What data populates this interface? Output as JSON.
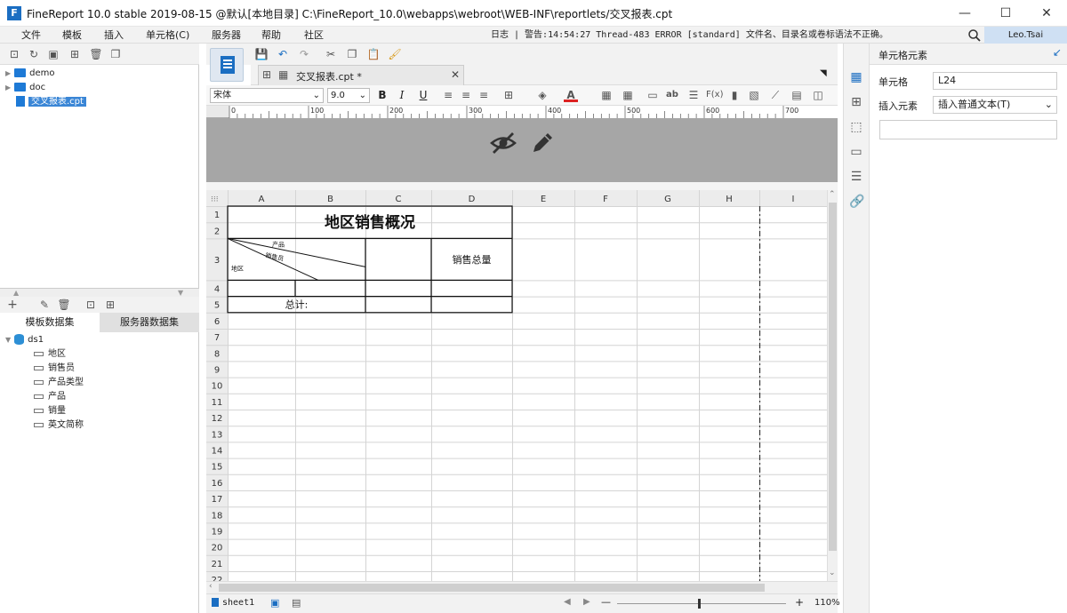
{
  "window": {
    "title": "FineReport 10.0 stable 2019-08-15 @默认[本地目录]    C:\\FineReport_10.0\\webapps\\webroot\\WEB-INF\\reportlets/交叉报表.cpt",
    "app_logo": "F",
    "minimize": "—",
    "maximize": "☐",
    "close": "✕"
  },
  "menu": {
    "items": [
      "文件",
      "模板",
      "插入",
      "单元格(C)",
      "服务器",
      "帮助",
      "社区"
    ],
    "log_text": "日志 | 警告:14:54:27 Thread-483 ERROR [standard] 文件名、目录名或卷标语法不正确。",
    "user": "Leo.Tsai"
  },
  "filetree": {
    "items": [
      {
        "label": "demo",
        "type": "folder"
      },
      {
        "label": "doc",
        "type": "folder"
      },
      {
        "label": "交叉报表.cpt",
        "type": "file",
        "selected": true
      }
    ]
  },
  "dataset": {
    "tabs": [
      "模板数据集",
      "服务器数据集"
    ],
    "active_tab": 0,
    "dataset_name": "ds1",
    "fields": [
      "地区",
      "销售员",
      "产品类型",
      "产品",
      "销量",
      "英文简称"
    ]
  },
  "editor": {
    "tab_label": "交叉报表.cpt *",
    "font_name": "宋体",
    "font_size": "9.0",
    "bold": "B",
    "italic": "I",
    "underline": "U",
    "ruler_marks": [
      "0",
      "100",
      "200",
      "300",
      "400",
      "500",
      "600",
      "700"
    ],
    "columns": [
      "A",
      "B",
      "C",
      "D",
      "E",
      "F",
      "G",
      "H",
      "I"
    ],
    "rows": [
      "1",
      "2",
      "3",
      "4",
      "5",
      "6",
      "7",
      "8",
      "9",
      "10",
      "11",
      "12",
      "13",
      "14",
      "15",
      "16",
      "17",
      "18",
      "19",
      "20",
      "21",
      "22"
    ],
    "report_title": "地区销售概况",
    "slash_labels": [
      "产品",
      "销售员",
      "地区"
    ],
    "total_sales_label": "销售总量",
    "total_label": "总计:",
    "sheet_name": "sheet1",
    "zoom": "110%",
    "zoom_minus": "—",
    "zoom_plus": "+"
  },
  "props": {
    "title": "单元格元素",
    "cell_label": "单元格",
    "cell_value": "L24",
    "insert_label": "插入元素",
    "insert_value": "插入普通文本(T)"
  }
}
